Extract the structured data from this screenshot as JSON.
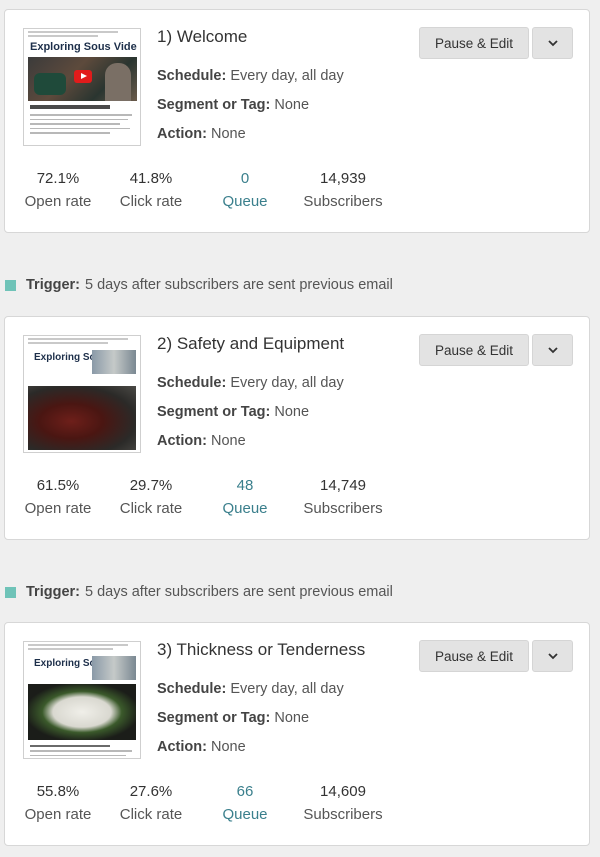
{
  "buttons": {
    "pause_edit": "Pause & Edit"
  },
  "labels": {
    "schedule": "Schedule:",
    "segment": "Segment or Tag:",
    "action": "Action:",
    "trigger": "Trigger:"
  },
  "emails": [
    {
      "title": "1) Welcome",
      "thumbnail_heading": "Exploring Sous Vide",
      "schedule": "Every day, all day",
      "segment": "None",
      "action": "None",
      "stats": {
        "open_rate": "72.1%",
        "open_label": "Open rate",
        "click_rate": "41.8%",
        "click_label": "Click rate",
        "queue": "0",
        "queue_label": "Queue",
        "subscribers": "14,939",
        "subscribers_label": "Subscribers"
      }
    },
    {
      "title": "2) Safety and Equipment",
      "thumbnail_heading": "Exploring Sous Vide",
      "schedule": "Every day, all day",
      "segment": "None",
      "action": "None",
      "stats": {
        "open_rate": "61.5%",
        "open_label": "Open rate",
        "click_rate": "29.7%",
        "click_label": "Click rate",
        "queue": "48",
        "queue_label": "Queue",
        "subscribers": "14,749",
        "subscribers_label": "Subscribers"
      }
    },
    {
      "title": "3) Thickness or Tenderness",
      "thumbnail_heading": "Exploring Sous Vide",
      "schedule": "Every day, all day",
      "segment": "None",
      "action": "None",
      "stats": {
        "open_rate": "55.8%",
        "open_label": "Open rate",
        "click_rate": "27.6%",
        "click_label": "Click rate",
        "queue": "66",
        "queue_label": "Queue",
        "subscribers": "14,609",
        "subscribers_label": "Subscribers"
      }
    }
  ],
  "triggers": [
    {
      "text": "5 days after subscribers are sent previous email"
    },
    {
      "text": "5 days after subscribers are sent previous email"
    }
  ],
  "colors": {
    "background": "#efefef",
    "card": "#ffffff",
    "queue_accent": "#3a7f8c",
    "trigger_marker": "#6fc3b8",
    "button": "#e3e3e3"
  },
  "icons": {
    "dropdown": "chevron-down-icon",
    "video_play": "play-icon",
    "trigger_marker": "square-marker-icon"
  }
}
